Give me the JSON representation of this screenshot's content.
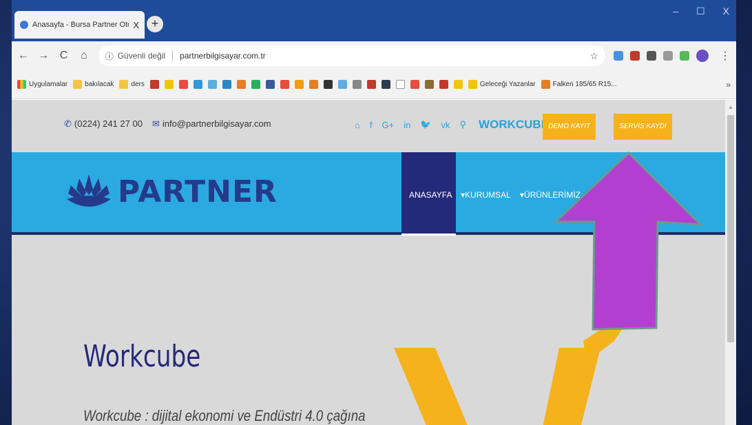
{
  "browser": {
    "tab_title": "Anasayfa - Bursa Partner Otomas",
    "tab_close": "X",
    "new_tab": "+",
    "window_controls": [
      "–",
      "☐",
      "X"
    ],
    "nav": {
      "back": "←",
      "forward": "→",
      "reload": "C",
      "home": "⌂"
    },
    "security_label": "Güvenli değil",
    "url": "partnerbilgisayar.com.tr",
    "bookmarks": [
      "Uygulamalar",
      "bakılacak",
      "ders",
      "Geleceği Yazanlar",
      "Falken 185/65 R15..."
    ],
    "bookmarks_more": "»"
  },
  "page": {
    "phone": "(0224) 241 27 00",
    "email": "info@partnerbilgisayar.com",
    "workcube_link": "WORKCUBE",
    "demo_button": "DEMO KAYIT",
    "servis_button": "SERVİS KAYDI",
    "logo_text": "PARTNER",
    "nav": [
      "ANASAYFA",
      "KURUMSAL",
      "ÜRÜNLERİMİZ"
    ],
    "hero_title": "Workcube",
    "hero_subtitle": "Workcube : dijital ekonomi ve Endüstri 4.0 çağına"
  },
  "colors": {
    "accent_blue": "#2aaae1",
    "navy": "#25297a",
    "orange": "#f6b21d",
    "arrow_purple": "#b33fd0"
  }
}
